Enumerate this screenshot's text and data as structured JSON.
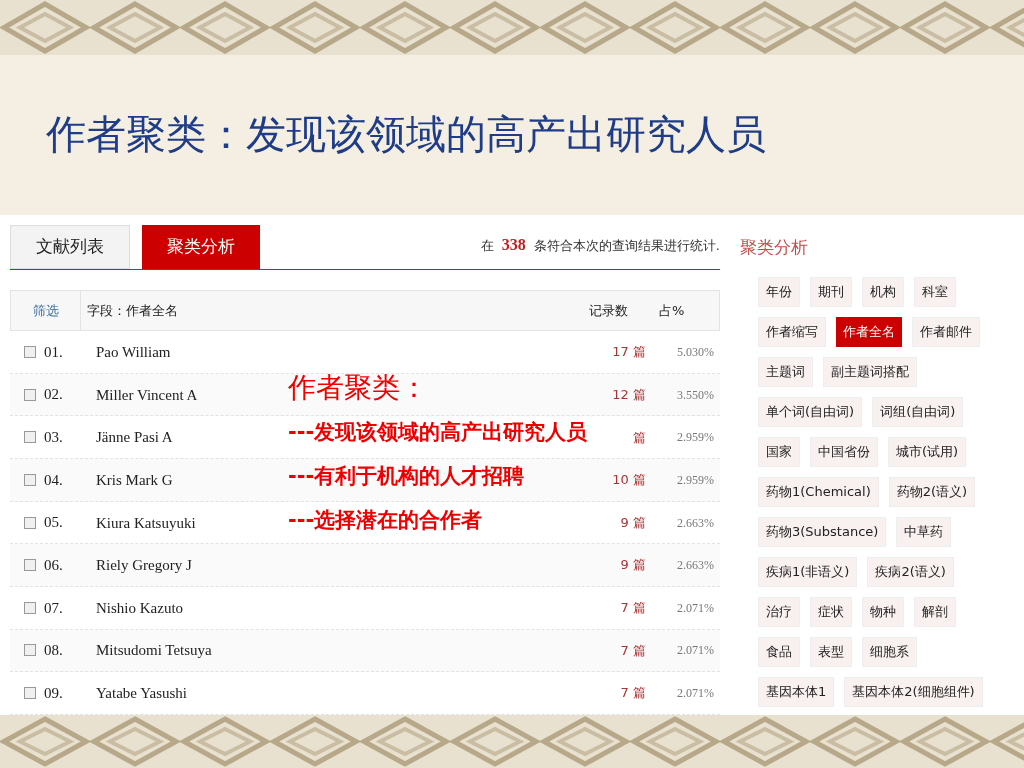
{
  "slide_title": "作者聚类：发现该领域的高产出研究人员",
  "tabs": [
    {
      "label": "文献列表",
      "selected": false
    },
    {
      "label": "聚类分析",
      "selected": true
    }
  ],
  "summary": {
    "prefix": "在",
    "count": "338",
    "suffix": "条符合本次的查询结果进行统计."
  },
  "table": {
    "columns": [
      "筛选",
      "字段：作者全名",
      "记录数",
      "占%"
    ],
    "rows": [
      {
        "checked": false,
        "index": "01.",
        "name": "Pao William",
        "count": "17 篇",
        "percent": "5.030%"
      },
      {
        "checked": false,
        "index": "02.",
        "name": "Miller Vincent A",
        "count": "12 篇",
        "percent": "3.550%"
      },
      {
        "checked": false,
        "index": "03.",
        "name": "Jänne Pasi A",
        "count": "篇",
        "percent": "2.959%"
      },
      {
        "checked": false,
        "index": "04.",
        "name": "Kris Mark G",
        "count": "10 篇",
        "percent": "2.959%"
      },
      {
        "checked": false,
        "index": "05.",
        "name": "Kiura Katsuyuki",
        "count": "9 篇",
        "percent": "2.663%"
      },
      {
        "checked": false,
        "index": "06.",
        "name": "Riely Gregory J",
        "count": "9 篇",
        "percent": "2.663%"
      },
      {
        "checked": false,
        "index": "07.",
        "name": "Nishio Kazuto",
        "count": "7 篇",
        "percent": "2.071%"
      },
      {
        "checked": false,
        "index": "08.",
        "name": "Mitsudomi Tetsuya",
        "count": "7 篇",
        "percent": "2.071%"
      },
      {
        "checked": false,
        "index": "09.",
        "name": "Yatabe Yasushi",
        "count": "7 篇",
        "percent": "2.071%"
      }
    ]
  },
  "annotation": {
    "heading": "作者聚类：",
    "lines": [
      "---发现该领域的高产出研究人员",
      "---有利于机构的人才招聘",
      "---选择潜在的合作者"
    ]
  },
  "sidebar": {
    "title": "聚类分析",
    "tag_rows": [
      [
        {
          "label": "年份",
          "selected": false
        },
        {
          "label": "期刊",
          "selected": false
        },
        {
          "label": "机构",
          "selected": false
        },
        {
          "label": "科室",
          "selected": false
        }
      ],
      [
        {
          "label": "作者缩写",
          "selected": false
        },
        {
          "label": "作者全名",
          "selected": true
        },
        {
          "label": "作者邮件",
          "selected": false
        }
      ],
      [
        {
          "label": "主题词",
          "selected": false
        },
        {
          "label": "副主题词搭配",
          "selected": false
        }
      ],
      [
        {
          "label": "单个词(自由词)",
          "selected": false
        },
        {
          "label": "词组(自由词)",
          "selected": false
        }
      ],
      [
        {
          "label": "国家",
          "selected": false
        },
        {
          "label": "中国省份",
          "selected": false
        },
        {
          "label": "城市(试用)",
          "selected": false
        }
      ],
      [
        {
          "label": "药物1(Chemical)",
          "selected": false
        },
        {
          "label": "药物2(语义)",
          "selected": false
        }
      ],
      [
        {
          "label": "药物3(Substance)",
          "selected": false
        },
        {
          "label": "中草药",
          "selected": false
        }
      ],
      [
        {
          "label": "疾病1(非语义)",
          "selected": false
        },
        {
          "label": "疾病2(语义)",
          "selected": false
        }
      ],
      [
        {
          "label": "治疗",
          "selected": false
        },
        {
          "label": "症状",
          "selected": false
        },
        {
          "label": "物种",
          "selected": false
        },
        {
          "label": "解剖",
          "selected": false
        }
      ],
      [
        {
          "label": "食品",
          "selected": false
        },
        {
          "label": "表型",
          "selected": false
        },
        {
          "label": "细胞系",
          "selected": false
        }
      ],
      [
        {
          "label": "基因本体1",
          "selected": false
        },
        {
          "label": "基因本体2(细胞组件)",
          "selected": false
        }
      ]
    ]
  }
}
